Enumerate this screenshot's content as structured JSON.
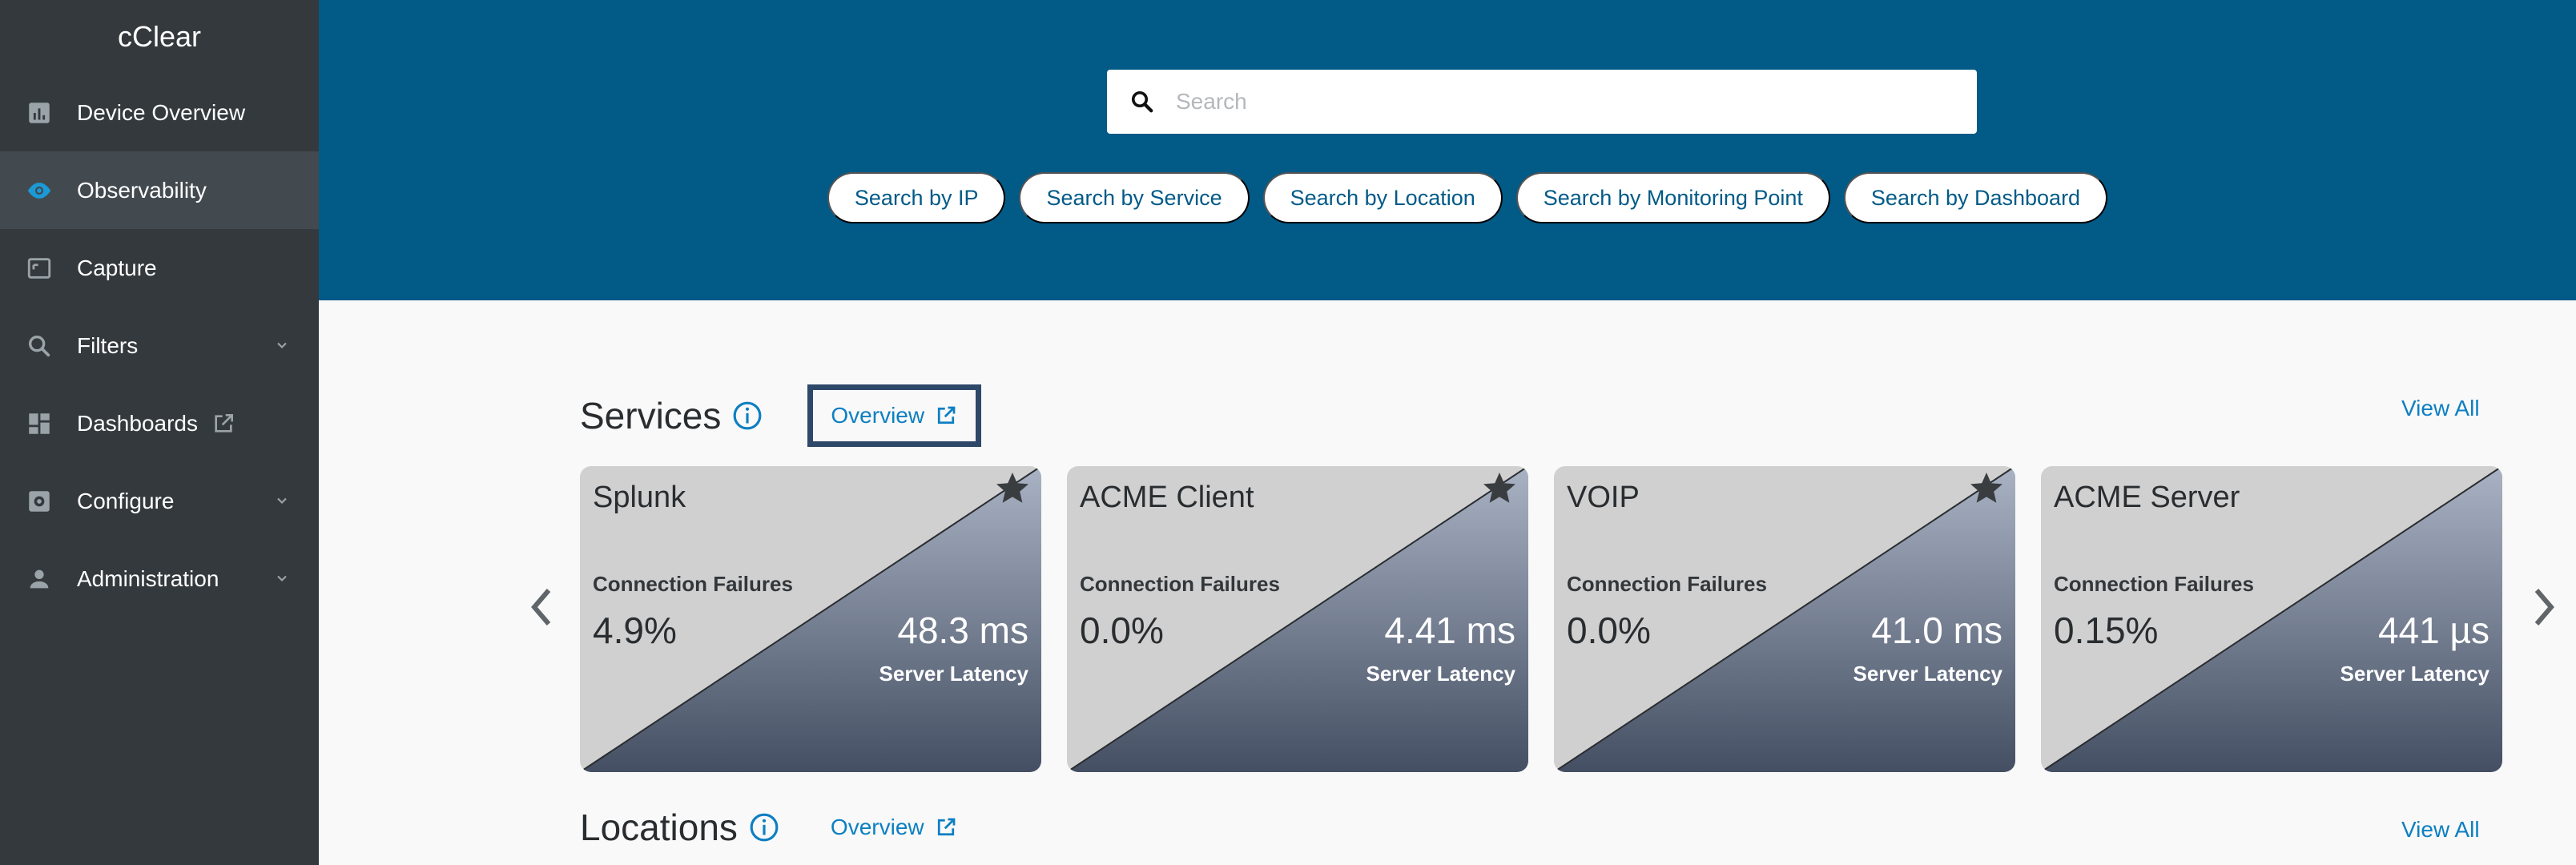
{
  "sidebar": {
    "brand": "cClear",
    "items": [
      {
        "label": "Device Overview",
        "icon": "bar-chart-icon"
      },
      {
        "label": "Observability",
        "icon": "eye-icon",
        "active": true
      },
      {
        "label": "Capture",
        "icon": "capture-icon"
      },
      {
        "label": "Filters",
        "icon": "search-icon",
        "expandable": true
      },
      {
        "label": "Dashboards",
        "icon": "dashboard-icon",
        "external": true
      },
      {
        "label": "Configure",
        "icon": "settings-icon",
        "expandable": true
      },
      {
        "label": "Administration",
        "icon": "person-icon",
        "expandable": true
      }
    ]
  },
  "search": {
    "placeholder": "Search",
    "buttons": [
      "Search by IP",
      "Search by Service",
      "Search by Location",
      "Search by Monitoring Point",
      "Search by Dashboard"
    ]
  },
  "services": {
    "title": "Services",
    "overview_label": "Overview",
    "view_all_label": "View All",
    "cards": [
      {
        "name": "Splunk",
        "connection_failures_label": "Connection Failures",
        "connection_failures": "4.9%",
        "server_latency": "48.3 ms",
        "server_latency_label": "Server Latency",
        "starred": true
      },
      {
        "name": "ACME Client",
        "connection_failures_label": "Connection Failures",
        "connection_failures": "0.0%",
        "server_latency": "4.41 ms",
        "server_latency_label": "Server Latency",
        "starred": true
      },
      {
        "name": "VOIP",
        "connection_failures_label": "Connection Failures",
        "connection_failures": "0.0%",
        "server_latency": "41.0 ms",
        "server_latency_label": "Server Latency",
        "starred": true
      },
      {
        "name": "ACME Server",
        "connection_failures_label": "Connection Failures",
        "connection_failures": "0.15%",
        "server_latency": "441 µs",
        "server_latency_label": "Server Latency",
        "starred": false
      }
    ]
  },
  "locations": {
    "title": "Locations",
    "overview_label": "Overview",
    "view_all_label": "View All"
  },
  "colors": {
    "sidebar_bg": "#33393d",
    "sidebar_active_bg": "#434a4f",
    "hero_bg": "#025a87",
    "link": "#0d7fc2",
    "accent": "#1a9ad6",
    "highlight_border": "#2e4869"
  }
}
